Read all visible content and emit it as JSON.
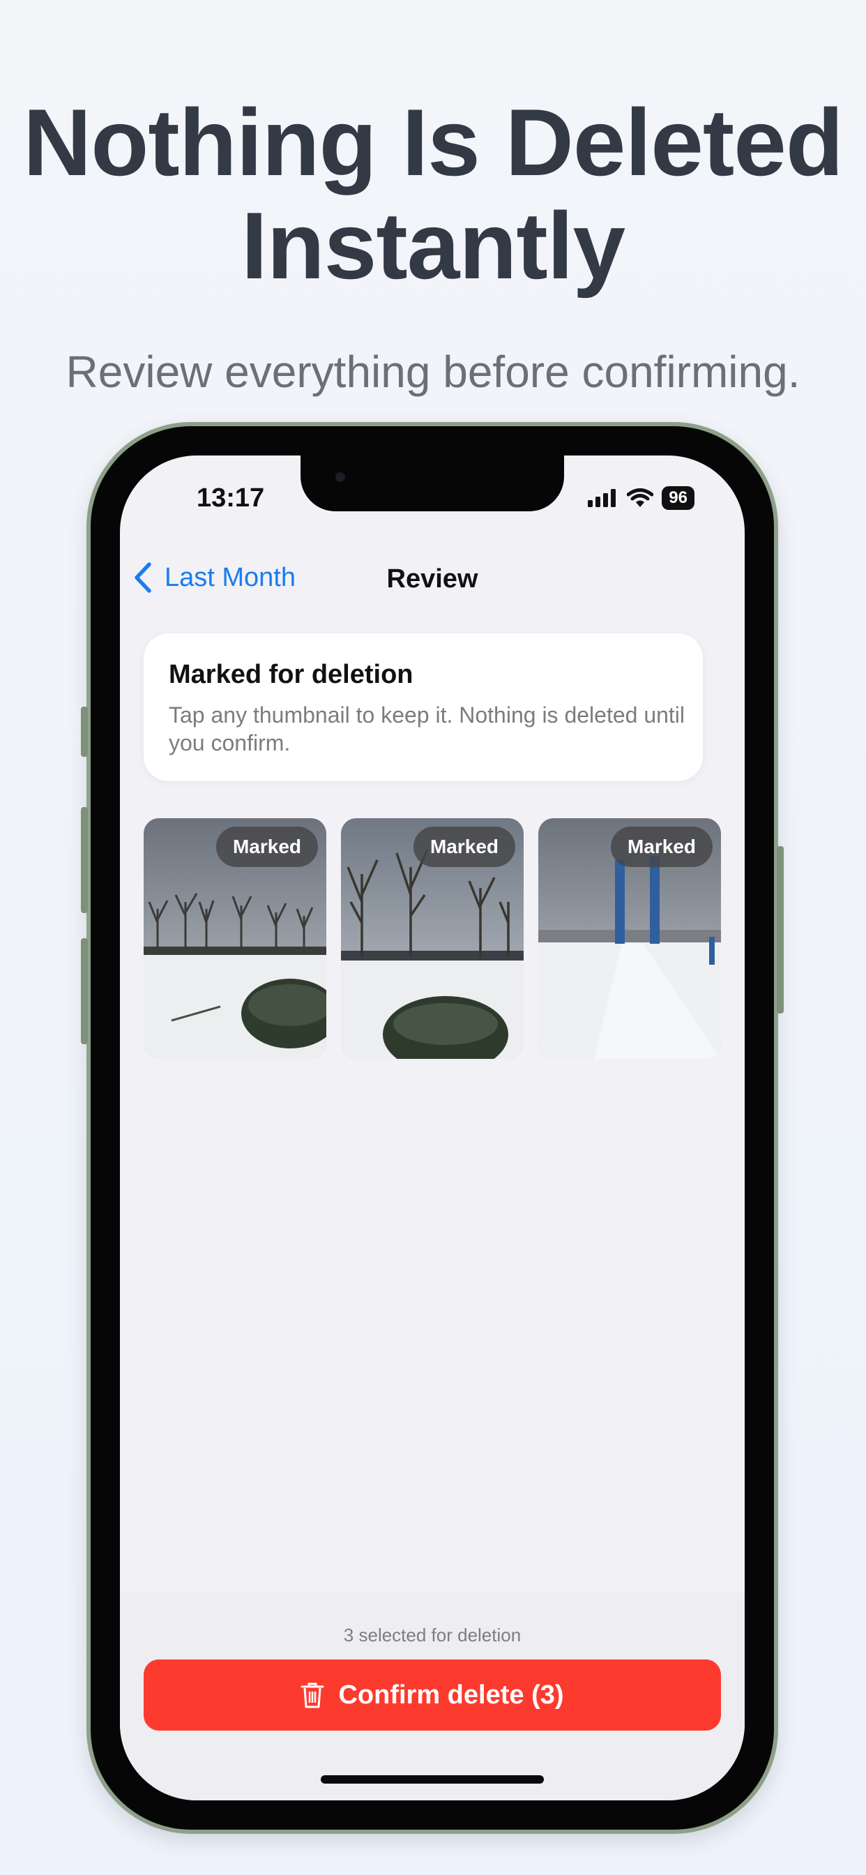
{
  "promo": {
    "headline_line1": "Nothing Is Deleted",
    "headline_line2": "Instantly",
    "subhead": "Review everything before confirming."
  },
  "status_bar": {
    "time": "13:17",
    "battery": "96",
    "icons": [
      "signal-icon",
      "wifi-icon",
      "battery-icon"
    ]
  },
  "nav": {
    "back_label": "Last Month",
    "title": "Review"
  },
  "info_card": {
    "title": "Marked for deletion",
    "body": "Tap any thumbnail to keep it. Nothing is deleted until you confirm."
  },
  "thumbnails": [
    {
      "badge": "Marked",
      "scene": "snowy park with bare trees and shrubs"
    },
    {
      "badge": "Marked",
      "scene": "snowy field with bare trees and bush"
    },
    {
      "badge": "Marked",
      "scene": "snowy path with blue poles and buildings"
    }
  ],
  "footer": {
    "selection_count": "3 selected for deletion",
    "confirm_label": "Confirm delete (3)"
  },
  "colors": {
    "accent_blue": "#1a7cf0",
    "destructive_red": "#fd3a2e",
    "headline": "#333a45"
  }
}
